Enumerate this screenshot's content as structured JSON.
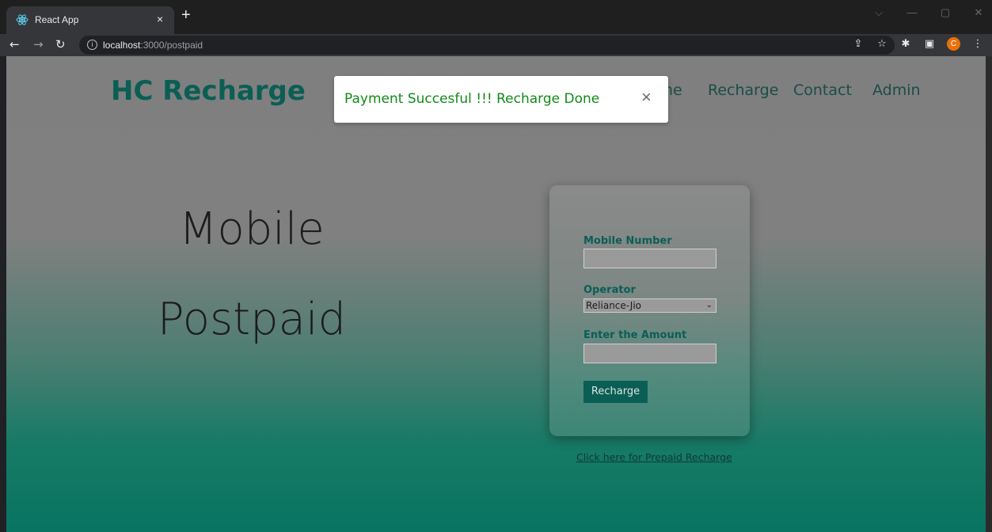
{
  "browser": {
    "tab_title": "React App",
    "tab_close": "×",
    "new_tab": "+",
    "url_host": "localhost",
    "url_path": ":3000/postpaid",
    "window_controls": [
      "⌵",
      "—",
      "▢",
      "✕"
    ]
  },
  "header": {
    "brand": "HC Recharge",
    "nav": {
      "home_partial": "ne",
      "recharge": "Recharge",
      "contact": "Contact",
      "admin": "Admin"
    }
  },
  "hero": {
    "line1": "Mobile",
    "line2": "Postpaid"
  },
  "form": {
    "mobile_label": "Mobile Number",
    "mobile_value": "",
    "operator_label": "Operator",
    "operator_selected": "Reliance-Jio",
    "amount_label": "Enter the Amount",
    "amount_value": "",
    "submit_label": "Recharge"
  },
  "prepaid_link": "Click here for Prepaid Recharge",
  "toast": {
    "message": "Payment Succesful !!! Recharge Done",
    "close": "×"
  },
  "colors": {
    "brand": "#0b5e54",
    "success": "#138a18",
    "avatar": "#e8710a"
  }
}
